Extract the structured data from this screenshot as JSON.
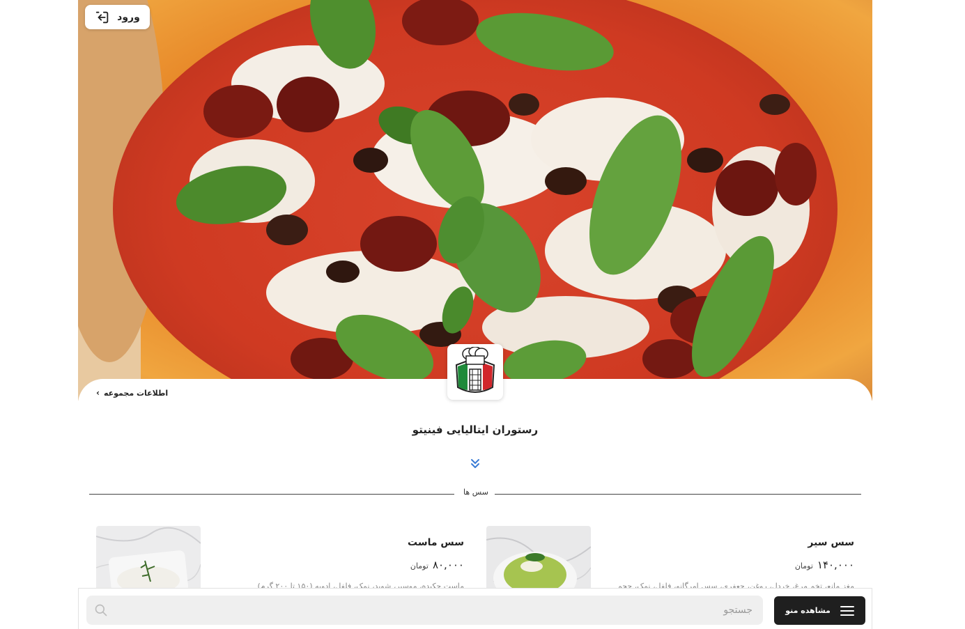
{
  "header": {
    "login_label": "ورود",
    "icons": {
      "login": "login-icon"
    }
  },
  "restaurant": {
    "info_link_label": "اطلاعات مجموعه",
    "name": "رستوران ایتالیایی فینیتو",
    "logo": "chef-tower-logo"
  },
  "section": {
    "title": "سس ها"
  },
  "menu_items": [
    {
      "title": "سس سیر",
      "price": "۱۴۰,۰۰۰",
      "currency": "تومان",
      "description": "مغز مانع، تخم مرغ، خردل، روغن، جعفری، سس امرگانو، فلفل، نمک، حجم"
    },
    {
      "title": "سس ماست",
      "price": "۸۰,۰۰۰",
      "currency": "تومان",
      "description": "ماست چکیده، موسیر، شوید، نمک، فلفل، ادویه (۱۵۰ تا ۲۰۰ گرم)"
    }
  ],
  "bottom_bar": {
    "search_placeholder": "جستجو",
    "view_menu_label": "مشاهده منو",
    "icons": {
      "search": "search-icon",
      "menu": "hamburger-icon"
    }
  },
  "colors": {
    "primary_dark": "#1f1f1f",
    "accent_blue": "#3a7bd5",
    "search_bg": "#efefef"
  }
}
